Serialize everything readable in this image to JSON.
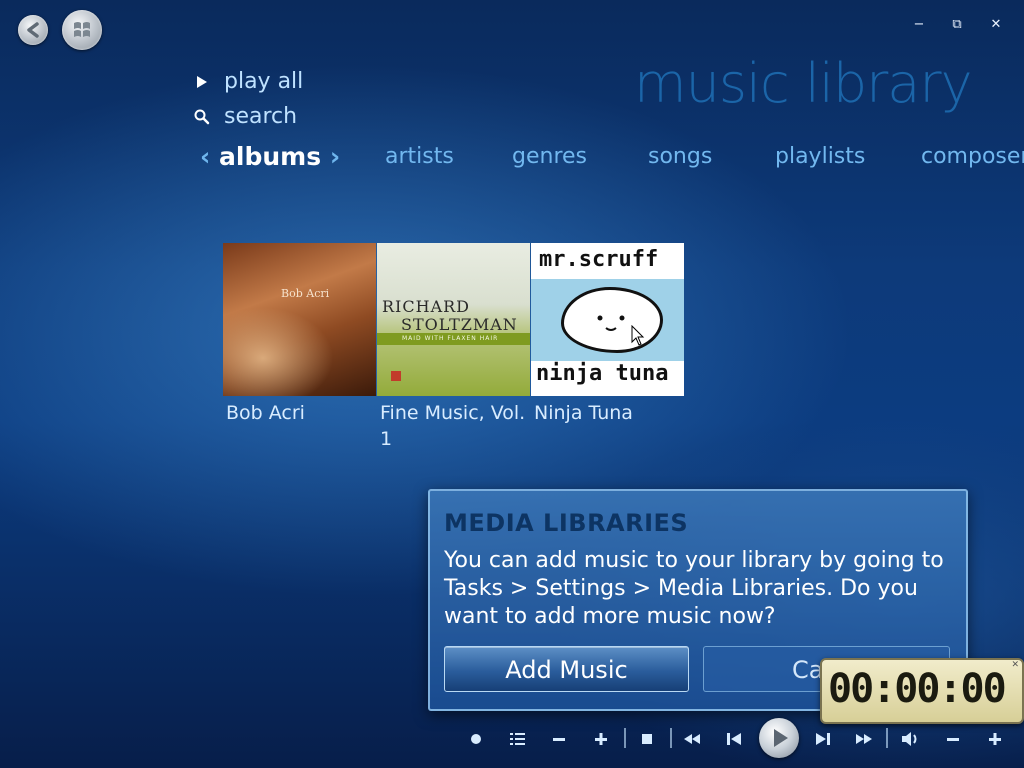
{
  "title": "music library",
  "window_controls": {
    "minimize": "−",
    "restore": "⧉",
    "close": "✕"
  },
  "menu": {
    "play_all": "play all",
    "search": "search"
  },
  "nav": {
    "left_arrow": "‹",
    "right_arrow": "›",
    "items": [
      "albums",
      "artists",
      "genres",
      "songs",
      "playlists",
      "composers"
    ],
    "selected": "albums"
  },
  "albums": [
    {
      "label": "Bob Acri",
      "cover_text": "Bob Acri"
    },
    {
      "label": "Fine Music, Vol. 1",
      "cover_artist": "RICHARD",
      "cover_artist2": "STOLTZMAN",
      "cover_subtitle": "MAID WITH FLAXEN HAIR"
    },
    {
      "label": "Ninja Tuna",
      "cover_top": "mr.scruff",
      "cover_bottom": "ninja tuna"
    }
  ],
  "dialog": {
    "title": "MEDIA LIBRARIES",
    "body": "You can add music to your library by going to Tasks > Settings > Media Libraries. Do you want to add more music now?",
    "primary_button": "Add Music",
    "secondary_button": "Cancel"
  },
  "timer": {
    "display": "00:00:00"
  },
  "transport": {
    "icons": [
      "record-icon",
      "list-icon",
      "minus-icon",
      "plus-icon",
      "stop-icon",
      "rewind-icon",
      "previous-icon",
      "play-icon",
      "next-icon",
      "fast-forward-icon",
      "volume-icon",
      "volume-down-icon",
      "volume-up-icon"
    ]
  }
}
